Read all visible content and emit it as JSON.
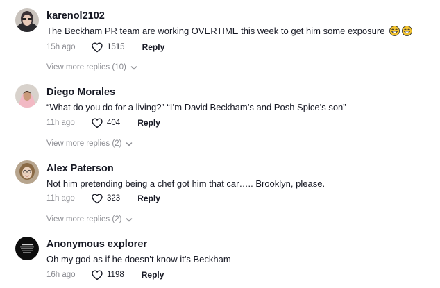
{
  "comments": [
    {
      "username": "karenol2102",
      "text": "The Beckham PR team are working OVERTIME this week to get him some exposure",
      "emojis": [
        "grinning-sweat-emoji",
        "grinning-sweat-emoji"
      ],
      "time": "15h ago",
      "likes": "1515",
      "reply_label": "Reply",
      "view_more": "View more replies (10)"
    },
    {
      "username": "Diego Morales",
      "text": "“What do you do for a living?” “I’m David Beckham’s and Posh Spice’s son”",
      "time": "11h ago",
      "likes": "404",
      "reply_label": "Reply",
      "view_more": "View more replies (2)"
    },
    {
      "username": "Alex Paterson",
      "text": "Not him pretending being a chef got him that car….. Brooklyn, please.",
      "time": "11h ago",
      "likes": "323",
      "reply_label": "Reply",
      "view_more": "View more replies (2)"
    },
    {
      "username": "Anonymous explorer",
      "text": "Oh my god as if he doesn’t know it’s Beckham",
      "time": "16h ago",
      "likes": "1198",
      "reply_label": "Reply"
    }
  ],
  "colors": {
    "primary_text": "#161823",
    "secondary_text": "#8a8b91",
    "background": "#ffffff"
  }
}
